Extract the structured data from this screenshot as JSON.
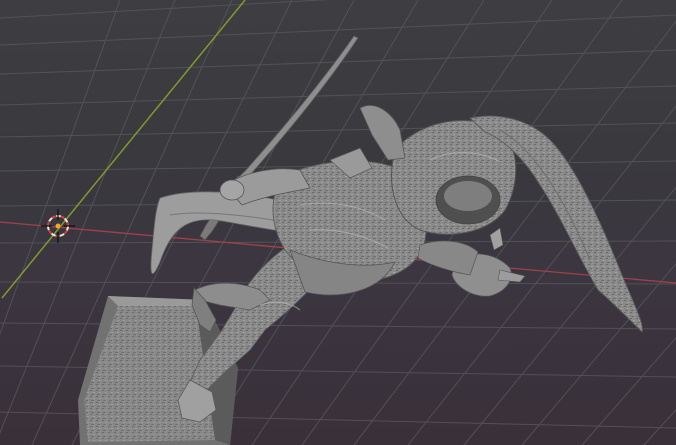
{
  "app": "Blender",
  "viewport": {
    "mode": "3d-view",
    "shading": "solid",
    "background_top": "#3e3e42",
    "background_bottom": "#3a3039",
    "grid_color": "#56565b",
    "x_axis_color": "#a3404a",
    "y_axis_color": "#7f9a2e",
    "object": "sculpted-figure-with-sword",
    "object_color": "#8c8c8c",
    "cursor": "3d-cursor"
  }
}
